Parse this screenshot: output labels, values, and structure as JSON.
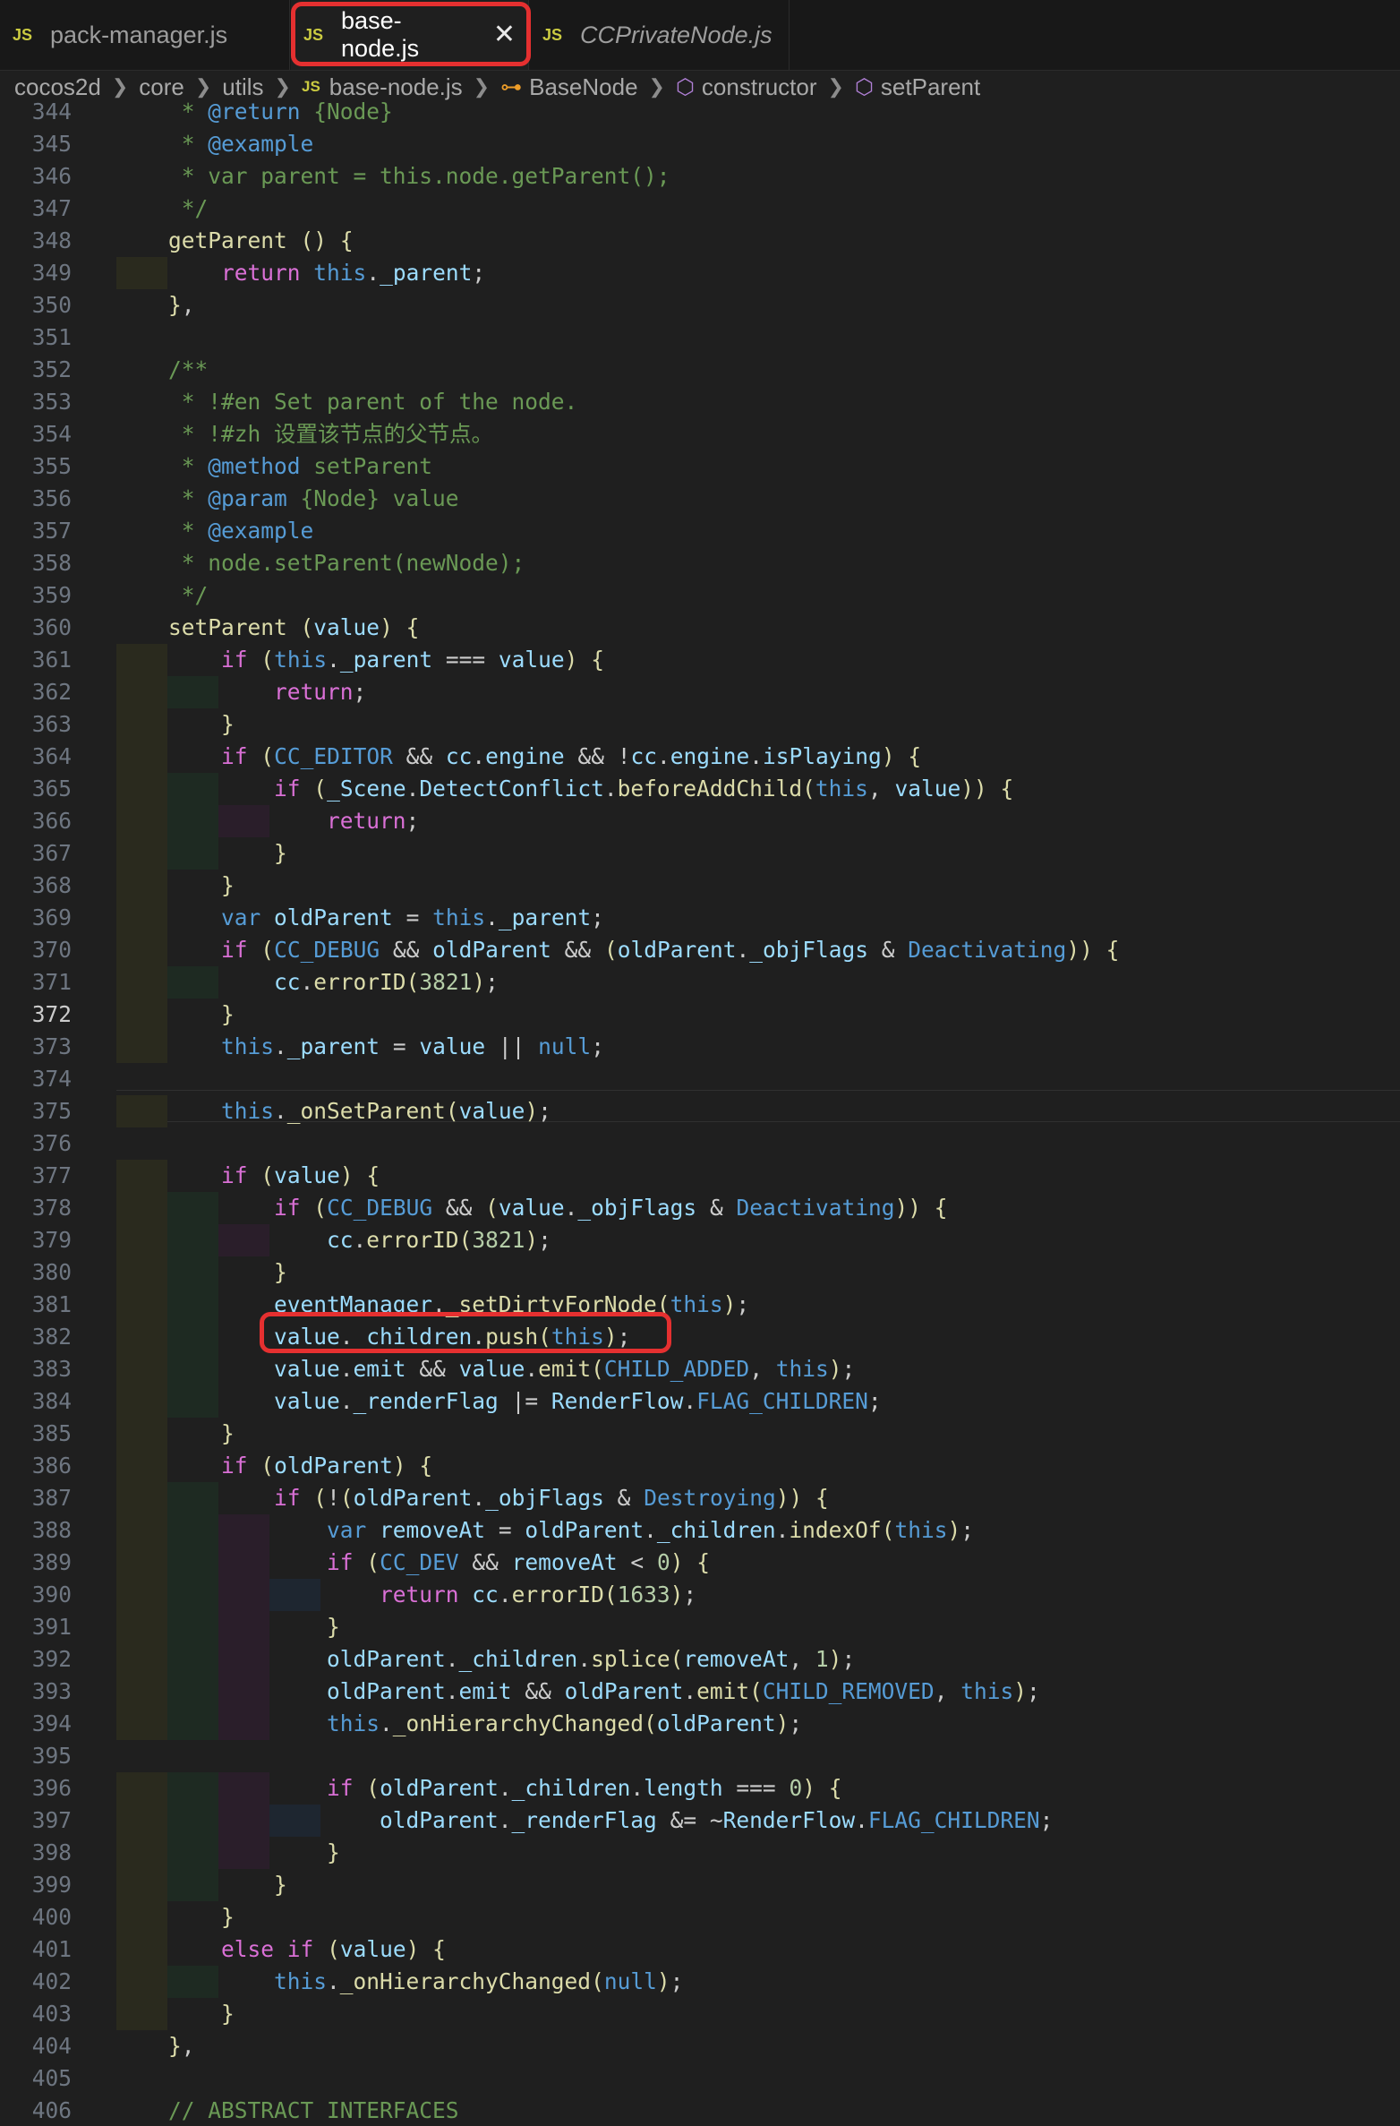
{
  "tabs": [
    {
      "label": "pack-manager.js",
      "icon": "js-file-icon",
      "badge": "JS",
      "active": false,
      "preview": false
    },
    {
      "label": "base-node.js",
      "icon": "js-file-icon",
      "badge": "JS",
      "active": true,
      "preview": false
    },
    {
      "label": "CCPrivateNode.js",
      "icon": "js-file-icon",
      "badge": "JS",
      "active": false,
      "preview": true
    }
  ],
  "breadcrumb": {
    "segments": [
      "cocos2d",
      "core",
      "utils",
      "base-node.js",
      "BaseNode",
      "constructor",
      "setParent"
    ],
    "icons": [
      "folder",
      "folder",
      "folder",
      "js-file-icon",
      "class-icon",
      "method-icon",
      "method-icon"
    ]
  },
  "editor": {
    "active_line": 372,
    "line_numbers": [
      "344",
      "345",
      "346",
      "347",
      "348",
      "349",
      "350",
      "351",
      "352",
      "353",
      "354",
      "355",
      "356",
      "357",
      "358",
      "359",
      "360",
      "361",
      "362",
      "363",
      "364",
      "365",
      "366",
      "367",
      "368",
      "369",
      "370",
      "371",
      "372",
      "373",
      "374",
      "375",
      "376",
      "377",
      "378",
      "379",
      "380",
      "381",
      "382",
      "383",
      "384",
      "385",
      "386",
      "387",
      "388",
      "389",
      "390",
      "391",
      "392",
      "393",
      "394",
      "395",
      "396",
      "397",
      "398",
      "399",
      "400",
      "401",
      "402",
      "403",
      "404",
      "405",
      "406"
    ],
    "code_lines": [
      "     * @return {Node}",
      "     * @example",
      "     * var parent = this.node.getParent();",
      "     */",
      "    getParent () {",
      "        return this._parent;",
      "    },",
      "",
      "    /**",
      "     * !#en Set parent of the node.",
      "     * !#zh 设置该节点的父节点。",
      "     * @method setParent",
      "     * @param {Node} value",
      "     * @example",
      "     * node.setParent(newNode);",
      "     */",
      "    setParent (value) {",
      "        if (this._parent === value) {",
      "            return;",
      "        }",
      "        if (CC_EDITOR && cc.engine && !cc.engine.isPlaying) {",
      "            if (_Scene.DetectConflict.beforeAddChild(this, value)) {",
      "                return;",
      "            }",
      "        }",
      "        var oldParent = this._parent;",
      "        if (CC_DEBUG && oldParent && (oldParent._objFlags & Deactivating)) {",
      "            cc.errorID(3821);",
      "        }",
      "        this._parent = value || null;",
      "",
      "        this._onSetParent(value);",
      "",
      "        if (value) {",
      "            if (CC_DEBUG && (value._objFlags & Deactivating)) {",
      "                cc.errorID(3821);",
      "            }",
      "            eventManager._setDirtyForNode(this);",
      "            value._children.push(this);",
      "            value.emit && value.emit(CHILD_ADDED, this);",
      "            value._renderFlag |= RenderFlow.FLAG_CHILDREN;",
      "        }",
      "        if (oldParent) {",
      "            if (!(oldParent._objFlags & Destroying)) {",
      "                var removeAt = oldParent._children.indexOf(this);",
      "                if (CC_DEV && removeAt < 0) {",
      "                    return cc.errorID(1633);",
      "                }",
      "                oldParent._children.splice(removeAt, 1);",
      "                oldParent.emit && oldParent.emit(CHILD_REMOVED, this);",
      "                this._onHierarchyChanged(oldParent);",
      "",
      "                if (oldParent._children.length === 0) {",
      "                    oldParent._renderFlag &= ~RenderFlow.FLAG_CHILDREN;",
      "                }",
      "            }",
      "        }",
      "        else if (value) {",
      "            this._onHierarchyChanged(null);",
      "        }",
      "    },",
      "",
      "    // ABSTRACT INTERFACES"
    ]
  },
  "annotations": {
    "highlighted_tab": "base-node.js",
    "highlighted_line": 382
  },
  "colors": {
    "background": "#1f1f1f",
    "keyword": "#569cd6",
    "comment": "#6a9955",
    "function": "#dcdcaa",
    "variable": "#9cdcfe",
    "number": "#b5cea8",
    "highlight_box": "#e53030"
  }
}
